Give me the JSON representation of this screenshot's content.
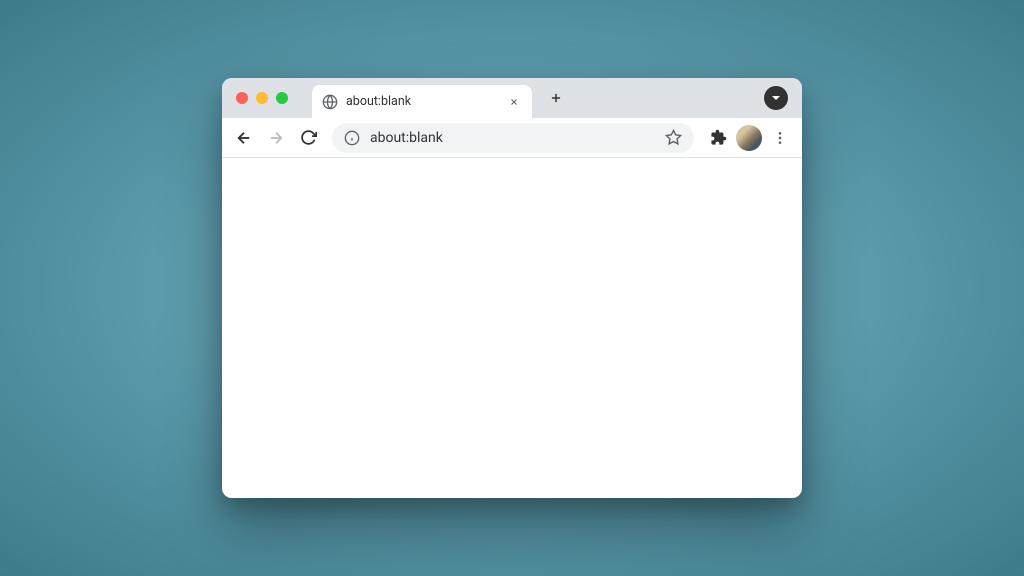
{
  "tab": {
    "title": "about:blank"
  },
  "omnibox": {
    "url": "about:blank"
  }
}
